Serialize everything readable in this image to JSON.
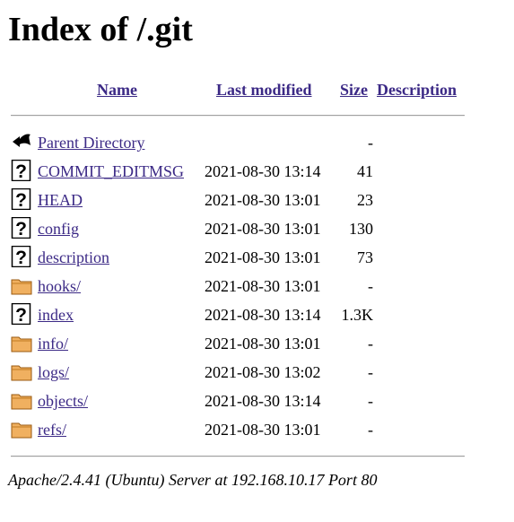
{
  "page": {
    "title": "Index of /.git"
  },
  "columns": {
    "name": "Name",
    "last_modified": "Last modified",
    "size": "Size",
    "description": "Description"
  },
  "entries": [
    {
      "name": "Parent Directory",
      "date": "",
      "size": "-",
      "icon": "back-arrow-icon"
    },
    {
      "name": "COMMIT_EDITMSG",
      "date": "2021-08-30 13:14",
      "size": "41",
      "icon": "unknown-file-icon"
    },
    {
      "name": "HEAD",
      "date": "2021-08-30 13:01",
      "size": "23",
      "icon": "unknown-file-icon"
    },
    {
      "name": "config",
      "date": "2021-08-30 13:01",
      "size": "130",
      "icon": "unknown-file-icon"
    },
    {
      "name": "description",
      "date": "2021-08-30 13:01",
      "size": "73",
      "icon": "unknown-file-icon"
    },
    {
      "name": "hooks/",
      "date": "2021-08-30 13:01",
      "size": "-",
      "icon": "folder-icon"
    },
    {
      "name": "index",
      "date": "2021-08-30 13:14",
      "size": "1.3K",
      "icon": "unknown-file-icon"
    },
    {
      "name": "info/",
      "date": "2021-08-30 13:01",
      "size": "-",
      "icon": "folder-icon"
    },
    {
      "name": "logs/",
      "date": "2021-08-30 13:02",
      "size": "-",
      "icon": "folder-icon"
    },
    {
      "name": "objects/",
      "date": "2021-08-30 13:14",
      "size": "-",
      "icon": "folder-icon"
    },
    {
      "name": "refs/",
      "date": "2021-08-30 13:01",
      "size": "-",
      "icon": "folder-icon"
    }
  ],
  "footer": {
    "server": "Apache/2.4.41 (Ubuntu) Server at 192.168.10.17 Port 80"
  },
  "colors": {
    "link": "#3c2a86",
    "folder": "#f0b060",
    "text": "#000000"
  }
}
